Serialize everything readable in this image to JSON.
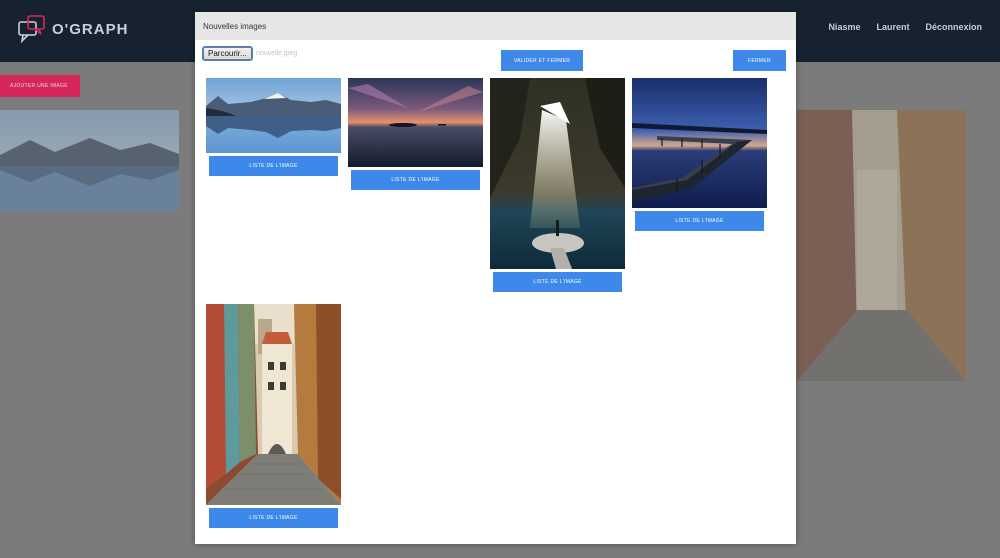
{
  "app": {
    "logo_text": "O'GRAPH",
    "nav": [
      "Niasme",
      "Laurent",
      "Déconnexion"
    ],
    "add_image_label": "AJOUTER UNE IMAGE"
  },
  "modal": {
    "title": "Nouvelles images",
    "browse_label": "Parcourir...",
    "file_name": "nouvelle.jpeg",
    "validate_label": "VALIDER ET FERMER",
    "close_label": "FERMER",
    "cards": [
      {
        "scene": "mountain-lake",
        "button_label": "LISTE DE L'IMAGE"
      },
      {
        "scene": "sunset-sea",
        "button_label": "LISTE DE L'IMAGE"
      },
      {
        "scene": "cave-light",
        "button_label": "LISTE DE L'IMAGE"
      },
      {
        "scene": "pier-night",
        "button_label": "LISTE DE L'IMAGE"
      },
      {
        "scene": "old-street",
        "button_label": "LISTE DE L'IMAGE"
      }
    ]
  },
  "colors": {
    "topbar": "#172231",
    "accent_pink": "#d6275a",
    "button_blue": "#3e88ea",
    "overlay": "#7b7b7b"
  }
}
